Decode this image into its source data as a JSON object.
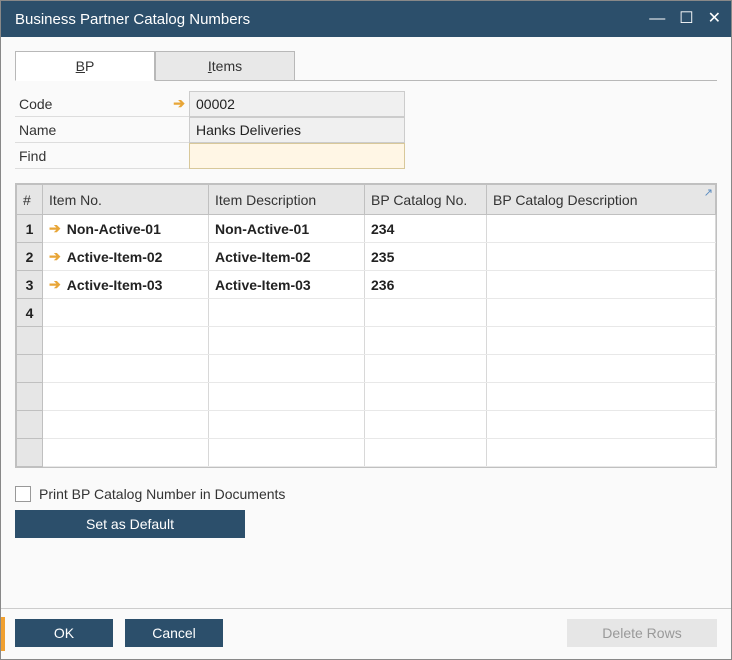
{
  "window": {
    "title": "Business Partner Catalog Numbers"
  },
  "tabs": {
    "bp": "BP",
    "items": "Items"
  },
  "form": {
    "code_label": "Code",
    "code_value": "00002",
    "name_label": "Name",
    "name_value": "Hanks Deliveries",
    "find_label": "Find",
    "find_value": ""
  },
  "table": {
    "headers": {
      "num": "#",
      "item_no": "Item No.",
      "item_desc": "Item Description",
      "bp_cat_no": "BP Catalog No.",
      "bp_cat_desc": "BP Catalog Description"
    },
    "rows": [
      {
        "num": "1",
        "item_no": "Non-Active-01",
        "item_desc": "Non-Active-01",
        "bp_cat_no": "234",
        "bp_cat_desc": ""
      },
      {
        "num": "2",
        "item_no": "Active-Item-02",
        "item_desc": "Active-Item-02",
        "bp_cat_no": "235",
        "bp_cat_desc": ""
      },
      {
        "num": "3",
        "item_no": "Active-Item-03",
        "item_desc": "Active-Item-03",
        "bp_cat_no": "236",
        "bp_cat_desc": ""
      }
    ],
    "empty_start": "4"
  },
  "checkbox": {
    "label": "Print BP Catalog Number in Documents"
  },
  "buttons": {
    "set_default": "Set as Default",
    "ok": "OK",
    "cancel": "Cancel",
    "delete_rows": "Delete Rows"
  }
}
